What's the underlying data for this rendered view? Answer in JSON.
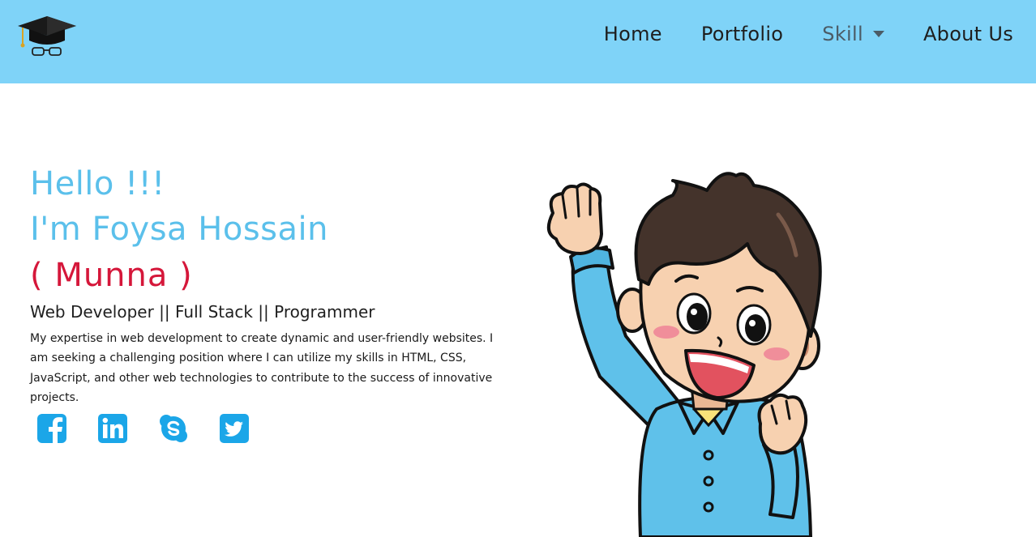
{
  "nav": {
    "logo_icon": "graduation-cap-glasses-icon",
    "items": [
      {
        "label": "Home"
      },
      {
        "label": "Portfolio"
      },
      {
        "label": "Skill",
        "has_dropdown": true
      },
      {
        "label": "About Us"
      }
    ]
  },
  "hero": {
    "greeting": "Hello !!!",
    "name": "I'm Foysa Hossain",
    "nickname": "( Munna )",
    "roles": "Web Developer || Full Stack || Programmer",
    "bio": "My expertise in web development to create dynamic and user-friendly websites. I am seeking a challenging position where I can utilize my skills in HTML, CSS, JavaScript, and other web technologies to contribute to the success of innovative projects."
  },
  "socials": [
    {
      "icon": "facebook-icon"
    },
    {
      "icon": "linkedin-icon"
    },
    {
      "icon": "skype-icon"
    },
    {
      "icon": "twitter-icon"
    }
  ],
  "colors": {
    "navbar": "#7fd3f8",
    "accent": "#5bc0eb",
    "nickname": "#d5173a",
    "social": "#1ba6e8"
  }
}
